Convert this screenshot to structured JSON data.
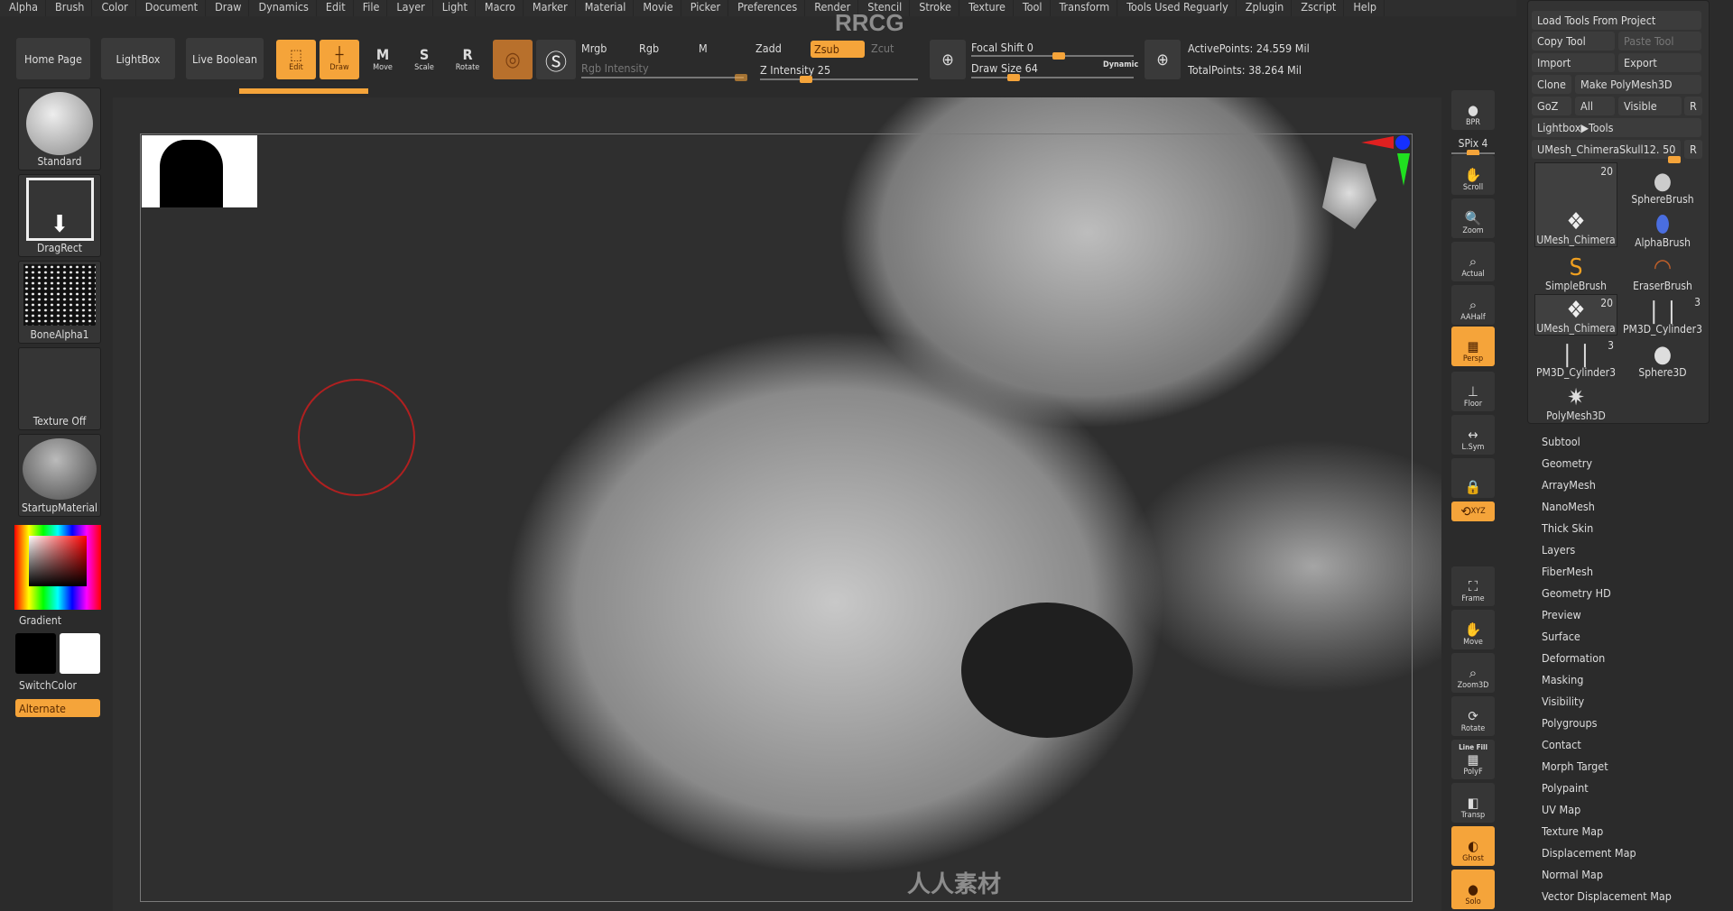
{
  "menu": [
    "Alpha",
    "Brush",
    "Color",
    "Document",
    "Draw",
    "Dynamics",
    "Edit",
    "File",
    "Layer",
    "Light",
    "Macro",
    "Marker",
    "Material",
    "Movie",
    "Picker",
    "Preferences",
    "Render",
    "Stencil",
    "Stroke",
    "Texture",
    "Tool",
    "Transform",
    "Tools Used Reguarly",
    "Zplugin",
    "Zscript",
    "Help"
  ],
  "watermark": "RRCG",
  "toolbar": {
    "home": "Home Page",
    "lightbox": "LightBox",
    "live_boolean": "Live Boolean",
    "edit": "Edit",
    "draw": "Draw",
    "move": "Move",
    "scale": "Scale",
    "rotate": "Rotate",
    "mrgb": "Mrgb",
    "rgb": "Rgb",
    "m": "M",
    "rgb_intensity": "Rgb Intensity",
    "zadd": "Zadd",
    "zsub": "Zsub",
    "zcut": "Zcut",
    "z_intensity": "Z Intensity 25",
    "z_intensity_value": 25,
    "focal_shift": "Focal Shift 0",
    "focal_shift_value": 0,
    "draw_size": "Draw Size 64",
    "draw_size_value": 64,
    "dynamic": "Dynamic",
    "active_points": "ActivePoints: 24.559 Mil",
    "total_points": "TotalPoints: 38.264 Mil"
  },
  "left": {
    "brush": "Standard",
    "stroke": "DragRect",
    "alpha": "BoneAlpha1",
    "texture": "Texture Off",
    "material": "StartupMaterial",
    "gradient": "Gradient",
    "switch_color": "SwitchColor",
    "alternate": "Alternate"
  },
  "shelf": [
    {
      "label": "BPR",
      "icon": "bpr-sphere-icon"
    },
    {
      "label": "SPix 4",
      "icon": "slider"
    },
    {
      "label": "Scroll",
      "icon": "hand-icon"
    },
    {
      "label": "Zoom",
      "icon": "zoom-icon"
    },
    {
      "label": "Actual",
      "icon": "zoom-actual-icon"
    },
    {
      "label": "AAHalf",
      "icon": "zoom-half-icon"
    },
    {
      "label": "Persp",
      "icon": "perspective-grid-icon",
      "active": true
    },
    {
      "label": "Floor",
      "icon": "floor-icon"
    },
    {
      "label": "L.Sym",
      "icon": "symmetry-icon"
    },
    {
      "label": "",
      "icon": "lock-camera-icon"
    },
    {
      "label": "XYZ",
      "icon": "rotate-xyz-icon",
      "active": true
    },
    {
      "label": "Frame",
      "icon": "frame-icon"
    },
    {
      "label": "Move",
      "icon": "move-hand-icon"
    },
    {
      "label": "Zoom3D",
      "icon": "zoom3d-icon"
    },
    {
      "label": "Rotate",
      "icon": "rotate-icon"
    },
    {
      "label": "PolyF",
      "icon": "polyframe-icon",
      "top": "Line Fill"
    },
    {
      "label": "Transp",
      "icon": "transparency-icon"
    },
    {
      "label": "Ghost",
      "icon": "ghost-icon",
      "active": true
    },
    {
      "label": "Solo",
      "icon": "solo-icon",
      "active": true
    }
  ],
  "right": {
    "load_tools_from_project": "Load Tools From Project",
    "copy_tool": "Copy Tool",
    "paste_tool": "Paste Tool",
    "import": "Import",
    "export": "Export",
    "clone": "Clone",
    "make_polymesh": "Make PolyMesh3D",
    "goz": "GoZ",
    "all": "All",
    "visible": "Visible",
    "r": "R",
    "lightbox_tools": "Lightbox▶Tools",
    "current_tool": "UMesh_ChimeraSkull12. 50",
    "tools": [
      {
        "name": "UMesh_Chimera",
        "count": "20"
      },
      {
        "name": "SphereBrush",
        "count": ""
      },
      {
        "name": "AlphaBrush",
        "count": ""
      },
      {
        "name": "SimpleBrush",
        "count": ""
      },
      {
        "name": "EraserBrush",
        "count": ""
      },
      {
        "name": "UMesh_Chimera",
        "count": "20"
      },
      {
        "name": "PM3D_Cylinder3",
        "count": "3"
      },
      {
        "name": "PM3D_Cylinder3",
        "count": "3"
      },
      {
        "name": "Sphere3D",
        "count": ""
      },
      {
        "name": "PolyMesh3D",
        "count": ""
      }
    ],
    "subpalettes": [
      "Subtool",
      "Geometry",
      "ArrayMesh",
      "NanoMesh",
      "Thick Skin",
      "Layers",
      "FiberMesh",
      "Geometry HD",
      "Preview",
      "Surface",
      "Deformation",
      "Masking",
      "Visibility",
      "Polygroups",
      "Contact",
      "Morph Target",
      "Polypaint",
      "UV Map",
      "Texture Map",
      "Displacement Map",
      "Normal Map",
      "Vector Displacement Map"
    ]
  },
  "footer_watermark": "人人素材",
  "colors": {
    "accent": "#f5a43a",
    "background": "#2b2b2b"
  }
}
